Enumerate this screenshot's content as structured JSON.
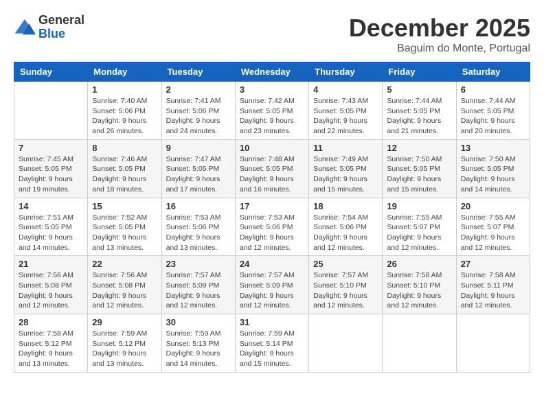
{
  "header": {
    "logo_general": "General",
    "logo_blue": "Blue",
    "month_title": "December 2025",
    "location": "Baguim do Monte, Portugal"
  },
  "calendar": {
    "days_of_week": [
      "Sunday",
      "Monday",
      "Tuesday",
      "Wednesday",
      "Thursday",
      "Friday",
      "Saturday"
    ],
    "weeks": [
      [
        {
          "day": "",
          "info": ""
        },
        {
          "day": "1",
          "info": "Sunrise: 7:40 AM\nSunset: 5:06 PM\nDaylight: 9 hours\nand 26 minutes."
        },
        {
          "day": "2",
          "info": "Sunrise: 7:41 AM\nSunset: 5:06 PM\nDaylight: 9 hours\nand 24 minutes."
        },
        {
          "day": "3",
          "info": "Sunrise: 7:42 AM\nSunset: 5:05 PM\nDaylight: 9 hours\nand 23 minutes."
        },
        {
          "day": "4",
          "info": "Sunrise: 7:43 AM\nSunset: 5:05 PM\nDaylight: 9 hours\nand 22 minutes."
        },
        {
          "day": "5",
          "info": "Sunrise: 7:44 AM\nSunset: 5:05 PM\nDaylight: 9 hours\nand 21 minutes."
        },
        {
          "day": "6",
          "info": "Sunrise: 7:44 AM\nSunset: 5:05 PM\nDaylight: 9 hours\nand 20 minutes."
        }
      ],
      [
        {
          "day": "7",
          "info": "Sunrise: 7:45 AM\nSunset: 5:05 PM\nDaylight: 9 hours\nand 19 minutes."
        },
        {
          "day": "8",
          "info": "Sunrise: 7:46 AM\nSunset: 5:05 PM\nDaylight: 9 hours\nand 18 minutes."
        },
        {
          "day": "9",
          "info": "Sunrise: 7:47 AM\nSunset: 5:05 PM\nDaylight: 9 hours\nand 17 minutes."
        },
        {
          "day": "10",
          "info": "Sunrise: 7:48 AM\nSunset: 5:05 PM\nDaylight: 9 hours\nand 16 minutes."
        },
        {
          "day": "11",
          "info": "Sunrise: 7:49 AM\nSunset: 5:05 PM\nDaylight: 9 hours\nand 15 minutes."
        },
        {
          "day": "12",
          "info": "Sunrise: 7:50 AM\nSunset: 5:05 PM\nDaylight: 9 hours\nand 15 minutes."
        },
        {
          "day": "13",
          "info": "Sunrise: 7:50 AM\nSunset: 5:05 PM\nDaylight: 9 hours\nand 14 minutes."
        }
      ],
      [
        {
          "day": "14",
          "info": "Sunrise: 7:51 AM\nSunset: 5:05 PM\nDaylight: 9 hours\nand 14 minutes."
        },
        {
          "day": "15",
          "info": "Sunrise: 7:52 AM\nSunset: 5:05 PM\nDaylight: 9 hours\nand 13 minutes."
        },
        {
          "day": "16",
          "info": "Sunrise: 7:53 AM\nSunset: 5:06 PM\nDaylight: 9 hours\nand 13 minutes."
        },
        {
          "day": "17",
          "info": "Sunrise: 7:53 AM\nSunset: 5:06 PM\nDaylight: 9 hours\nand 12 minutes."
        },
        {
          "day": "18",
          "info": "Sunrise: 7:54 AM\nSunset: 5:06 PM\nDaylight: 9 hours\nand 12 minutes."
        },
        {
          "day": "19",
          "info": "Sunrise: 7:55 AM\nSunset: 5:07 PM\nDaylight: 9 hours\nand 12 minutes."
        },
        {
          "day": "20",
          "info": "Sunrise: 7:55 AM\nSunset: 5:07 PM\nDaylight: 9 hours\nand 12 minutes."
        }
      ],
      [
        {
          "day": "21",
          "info": "Sunrise: 7:56 AM\nSunset: 5:08 PM\nDaylight: 9 hours\nand 12 minutes."
        },
        {
          "day": "22",
          "info": "Sunrise: 7:56 AM\nSunset: 5:08 PM\nDaylight: 9 hours\nand 12 minutes."
        },
        {
          "day": "23",
          "info": "Sunrise: 7:57 AM\nSunset: 5:09 PM\nDaylight: 9 hours\nand 12 minutes."
        },
        {
          "day": "24",
          "info": "Sunrise: 7:57 AM\nSunset: 5:09 PM\nDaylight: 9 hours\nand 12 minutes."
        },
        {
          "day": "25",
          "info": "Sunrise: 7:57 AM\nSunset: 5:10 PM\nDaylight: 9 hours\nand 12 minutes."
        },
        {
          "day": "26",
          "info": "Sunrise: 7:58 AM\nSunset: 5:10 PM\nDaylight: 9 hours\nand 12 minutes."
        },
        {
          "day": "27",
          "info": "Sunrise: 7:58 AM\nSunset: 5:11 PM\nDaylight: 9 hours\nand 12 minutes."
        }
      ],
      [
        {
          "day": "28",
          "info": "Sunrise: 7:58 AM\nSunset: 5:12 PM\nDaylight: 9 hours\nand 13 minutes."
        },
        {
          "day": "29",
          "info": "Sunrise: 7:59 AM\nSunset: 5:12 PM\nDaylight: 9 hours\nand 13 minutes."
        },
        {
          "day": "30",
          "info": "Sunrise: 7:59 AM\nSunset: 5:13 PM\nDaylight: 9 hours\nand 14 minutes."
        },
        {
          "day": "31",
          "info": "Sunrise: 7:59 AM\nSunset: 5:14 PM\nDaylight: 9 hours\nand 15 minutes."
        },
        {
          "day": "",
          "info": ""
        },
        {
          "day": "",
          "info": ""
        },
        {
          "day": "",
          "info": ""
        }
      ]
    ]
  }
}
